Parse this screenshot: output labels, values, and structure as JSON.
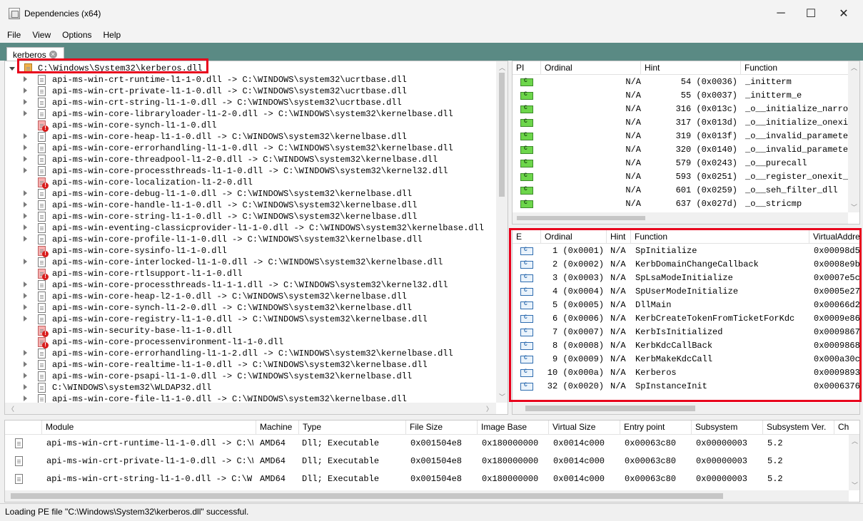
{
  "window": {
    "title": "Dependencies (x64)",
    "minimize": "─",
    "maximize": "☐",
    "close": "✕"
  },
  "menu": [
    "File",
    "View",
    "Options",
    "Help"
  ],
  "tab": {
    "label": "kerberos",
    "close": "✕"
  },
  "tree": {
    "root": "C:\\Windows\\System32\\kerberos.dll",
    "items": [
      {
        "text": "api-ms-win-crt-runtime-l1-1-0.dll -> C:\\WINDOWS\\system32\\ucrtbase.dll",
        "missing": false
      },
      {
        "text": "api-ms-win-crt-private-l1-1-0.dll -> C:\\WINDOWS\\system32\\ucrtbase.dll",
        "missing": false
      },
      {
        "text": "api-ms-win-crt-string-l1-1-0.dll -> C:\\WINDOWS\\system32\\ucrtbase.dll",
        "missing": false
      },
      {
        "text": "api-ms-win-core-libraryloader-l1-2-0.dll -> C:\\WINDOWS\\system32\\kernelbase.dll",
        "missing": false
      },
      {
        "text": "api-ms-win-core-synch-l1-1-0.dll",
        "missing": true
      },
      {
        "text": "api-ms-win-core-heap-l1-1-0.dll -> C:\\WINDOWS\\system32\\kernelbase.dll",
        "missing": false
      },
      {
        "text": "api-ms-win-core-errorhandling-l1-1-0.dll -> C:\\WINDOWS\\system32\\kernelbase.dll",
        "missing": false
      },
      {
        "text": "api-ms-win-core-threadpool-l1-2-0.dll -> C:\\WINDOWS\\system32\\kernelbase.dll",
        "missing": false
      },
      {
        "text": "api-ms-win-core-processthreads-l1-1-0.dll -> C:\\WINDOWS\\system32\\kernel32.dll",
        "missing": false
      },
      {
        "text": "api-ms-win-core-localization-l1-2-0.dll",
        "missing": true
      },
      {
        "text": "api-ms-win-core-debug-l1-1-0.dll -> C:\\WINDOWS\\system32\\kernelbase.dll",
        "missing": false
      },
      {
        "text": "api-ms-win-core-handle-l1-1-0.dll -> C:\\WINDOWS\\system32\\kernelbase.dll",
        "missing": false
      },
      {
        "text": "api-ms-win-core-string-l1-1-0.dll -> C:\\WINDOWS\\system32\\kernelbase.dll",
        "missing": false
      },
      {
        "text": "api-ms-win-eventing-classicprovider-l1-1-0.dll -> C:\\WINDOWS\\system32\\kernelbase.dll",
        "missing": false
      },
      {
        "text": "api-ms-win-core-profile-l1-1-0.dll -> C:\\WINDOWS\\system32\\kernelbase.dll",
        "missing": false
      },
      {
        "text": "api-ms-win-core-sysinfo-l1-1-0.dll",
        "missing": true
      },
      {
        "text": "api-ms-win-core-interlocked-l1-1-0.dll -> C:\\WINDOWS\\system32\\kernelbase.dll",
        "missing": false
      },
      {
        "text": "api-ms-win-core-rtlsupport-l1-1-0.dll",
        "missing": true
      },
      {
        "text": "api-ms-win-core-processthreads-l1-1-1.dll -> C:\\WINDOWS\\system32\\kernel32.dll",
        "missing": false
      },
      {
        "text": "api-ms-win-core-heap-l2-1-0.dll -> C:\\WINDOWS\\system32\\kernelbase.dll",
        "missing": false
      },
      {
        "text": "api-ms-win-core-synch-l1-2-0.dll -> C:\\WINDOWS\\system32\\kernelbase.dll",
        "missing": false
      },
      {
        "text": "api-ms-win-core-registry-l1-1-0.dll -> C:\\WINDOWS\\system32\\kernelbase.dll",
        "missing": false
      },
      {
        "text": "api-ms-win-security-base-l1-1-0.dll",
        "missing": true
      },
      {
        "text": "api-ms-win-core-processenvironment-l1-1-0.dll",
        "missing": true
      },
      {
        "text": "api-ms-win-core-errorhandling-l1-1-2.dll -> C:\\WINDOWS\\system32\\kernelbase.dll",
        "missing": false
      },
      {
        "text": "api-ms-win-core-realtime-l1-1-0.dll -> C:\\WINDOWS\\system32\\kernelbase.dll",
        "missing": false
      },
      {
        "text": "api-ms-win-core-psapi-l1-1-0.dll -> C:\\WINDOWS\\system32\\kernelbase.dll",
        "missing": false
      },
      {
        "text": "C:\\WINDOWS\\system32\\WLDAP32.dll",
        "missing": false
      },
      {
        "text": "api-ms-win-core-file-l1-1-0.dll -> C:\\WINDOWS\\system32\\kernelbase.dll",
        "missing": false
      }
    ]
  },
  "imports": {
    "headers": [
      "PI",
      "Ordinal",
      "Hint",
      "Function"
    ],
    "rows": [
      {
        "ordinal": "N/A",
        "hint": "54 (0x0036)",
        "function": "_initterm"
      },
      {
        "ordinal": "N/A",
        "hint": "55 (0x0037)",
        "function": "_initterm_e"
      },
      {
        "ordinal": "N/A",
        "hint": "316 (0x013c)",
        "function": "_o__initialize_narro"
      },
      {
        "ordinal": "N/A",
        "hint": "317 (0x013d)",
        "function": "_o__initialize_onexi"
      },
      {
        "ordinal": "N/A",
        "hint": "319 (0x013f)",
        "function": "_o__invalid_paramete"
      },
      {
        "ordinal": "N/A",
        "hint": "320 (0x0140)",
        "function": "_o__invalid_paramete"
      },
      {
        "ordinal": "N/A",
        "hint": "579 (0x0243)",
        "function": "_o__purecall"
      },
      {
        "ordinal": "N/A",
        "hint": "593 (0x0251)",
        "function": "_o__register_onexit_"
      },
      {
        "ordinal": "N/A",
        "hint": "601 (0x0259)",
        "function": "_o__seh_filter_dll"
      },
      {
        "ordinal": "N/A",
        "hint": "637 (0x027d)",
        "function": "_o__stricmp"
      }
    ]
  },
  "exports": {
    "headers": [
      "E",
      "Ordinal",
      "Hint",
      "Function",
      "VirtualAddre"
    ],
    "rows": [
      {
        "ordinal": "1 (0x0001)",
        "hint": "N/A",
        "function": "SpInitialize",
        "va": "0x00098d5"
      },
      {
        "ordinal": "2 (0x0002)",
        "hint": "N/A",
        "function": "KerbDomainChangeCallback",
        "va": "0x0008e9b"
      },
      {
        "ordinal": "3 (0x0003)",
        "hint": "N/A",
        "function": "SpLsaModeInitialize",
        "va": "0x0007e5c"
      },
      {
        "ordinal": "4 (0x0004)",
        "hint": "N/A",
        "function": "SpUserModeInitialize",
        "va": "0x0005e27"
      },
      {
        "ordinal": "5 (0x0005)",
        "hint": "N/A",
        "function": "DllMain",
        "va": "0x00066d2"
      },
      {
        "ordinal": "6 (0x0006)",
        "hint": "N/A",
        "function": "KerbCreateTokenFromTicketForKdc",
        "va": "0x0009e86"
      },
      {
        "ordinal": "7 (0x0007)",
        "hint": "N/A",
        "function": "KerbIsInitialized",
        "va": "0x0009867"
      },
      {
        "ordinal": "8 (0x0008)",
        "hint": "N/A",
        "function": "KerbKdcCallBack",
        "va": "0x0009868"
      },
      {
        "ordinal": "9 (0x0009)",
        "hint": "N/A",
        "function": "KerbMakeKdcCall",
        "va": "0x000a30c"
      },
      {
        "ordinal": "10 (0x000a)",
        "hint": "N/A",
        "function": "Kerberos",
        "va": "0x0009893"
      },
      {
        "ordinal": "32 (0x0020)",
        "hint": "N/A",
        "function": "SpInstanceInit",
        "va": "0x0006376"
      }
    ]
  },
  "modules": {
    "headers": [
      "Module",
      "Machine",
      "Type",
      "File Size",
      "Image Base",
      "Virtual Size",
      "Entry point",
      "Subsystem",
      "Subsystem Ver.",
      "Ch"
    ],
    "rows": [
      {
        "module": "api-ms-win-crt-runtime-l1-1-0.dll -> C:\\W",
        "machine": "AMD64",
        "type": "Dll; Executable",
        "filesize": "0x001504e8",
        "imagebase": "0x180000000",
        "vsize": "0x0014c000",
        "entry": "0x00063c80",
        "subsystem": "0x00000003",
        "subver": "5.2"
      },
      {
        "module": "api-ms-win-crt-private-l1-1-0.dll -> C:\\W",
        "machine": "AMD64",
        "type": "Dll; Executable",
        "filesize": "0x001504e8",
        "imagebase": "0x180000000",
        "vsize": "0x0014c000",
        "entry": "0x00063c80",
        "subsystem": "0x00000003",
        "subver": "5.2"
      },
      {
        "module": "api-ms-win-crt-string-l1-1-0.dll -> C:\\W",
        "machine": "AMD64",
        "type": "Dll; Executable",
        "filesize": "0x001504e8",
        "imagebase": "0x180000000",
        "vsize": "0x0014c000",
        "entry": "0x00063c80",
        "subsystem": "0x00000003",
        "subver": "5.2"
      }
    ]
  },
  "status": "Loading PE file \"C:\\Windows\\System32\\kerberos.dll\" successful.",
  "colors": {
    "highlight": "#e8001c",
    "tabstrip": "#5a8a84"
  }
}
